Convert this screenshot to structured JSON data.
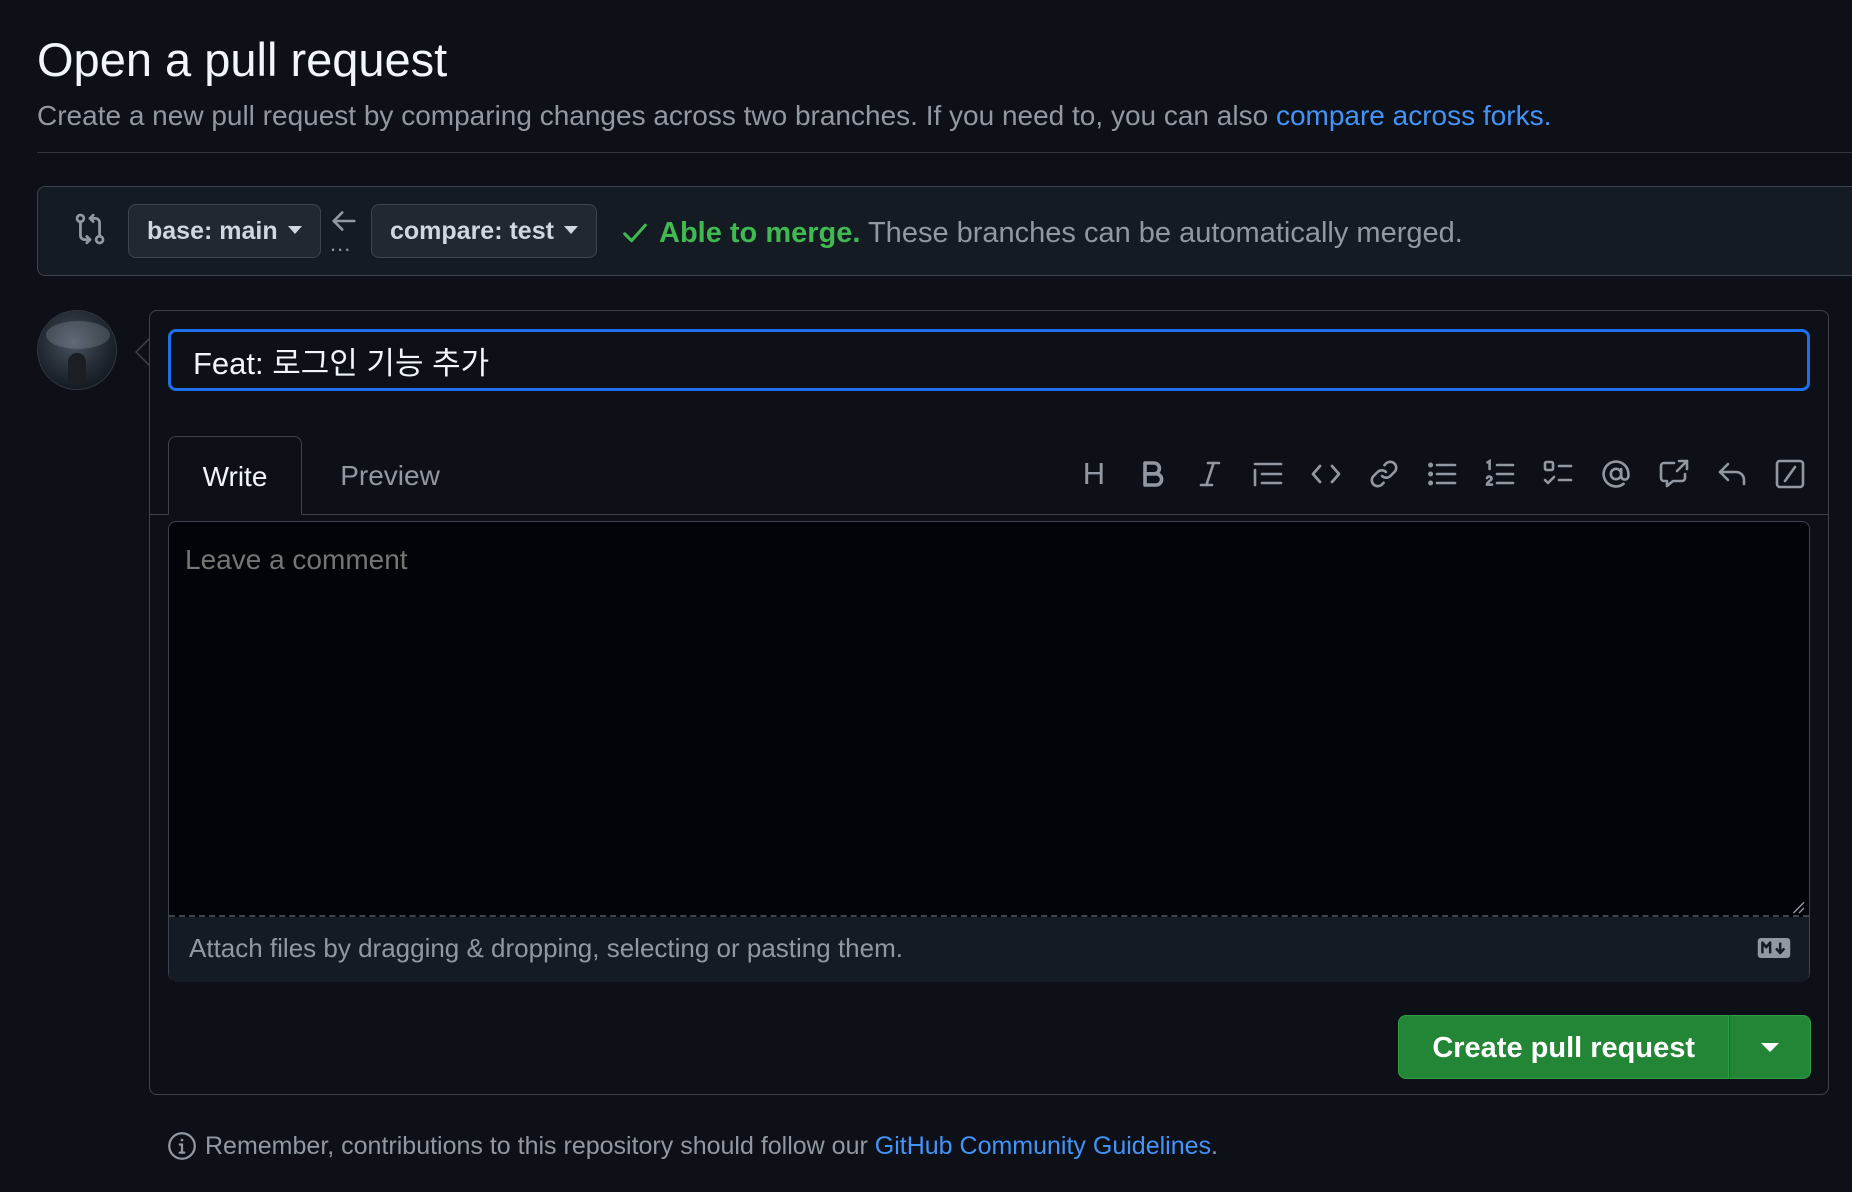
{
  "header": {
    "title": "Open a pull request",
    "subtitle": "Create a new pull request by comparing changes across two branches. If you need to, you can also ",
    "subtitle_link": "compare across forks.",
    "subtitle_link_dot": ""
  },
  "range": {
    "base_label": "base: main",
    "compare_label": "compare: test",
    "ellipsis": "...",
    "merge_ok": "Able to merge.",
    "merge_desc": " These branches can be automatically merged."
  },
  "editor": {
    "title_value": "Feat: 로그인 기능 추가",
    "tabs": [
      {
        "label": "Write",
        "active": true
      },
      {
        "label": "Preview",
        "active": false
      }
    ],
    "toolbar": {
      "heading_glyph": "H",
      "icons": [
        "heading-icon",
        "bold-icon",
        "italic-icon",
        "quote-icon",
        "code-icon",
        "link-icon",
        "unordered-list-icon",
        "ordered-list-icon",
        "task-list-icon",
        "mention-icon",
        "cross-reference-icon",
        "reply-icon",
        "slash-command-icon"
      ]
    },
    "comment_placeholder": "Leave a comment",
    "attach_text": "Attach files by dragging & dropping, selecting or pasting them."
  },
  "actions": {
    "create_label": "Create pull request"
  },
  "footer": {
    "text": "Remember, contributions to this repository should follow our ",
    "link": "GitHub Community Guidelines",
    "period": "."
  },
  "colors": {
    "background": "#0d1117",
    "accent_blue": "#4493f8",
    "success_green": "#3fb950",
    "button_green": "#238636",
    "focus_border": "#1f6feb"
  }
}
